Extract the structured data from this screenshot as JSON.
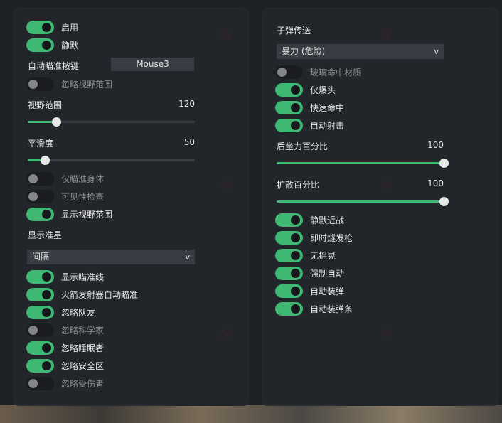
{
  "left": {
    "enable": {
      "label": "启用",
      "on": true
    },
    "silent": {
      "label": "静默",
      "on": true
    },
    "aim_key": {
      "label": "自动瞄准按键",
      "value": "Mouse3"
    },
    "ignore_fov": {
      "label": "忽略视野范围",
      "on": false
    },
    "fov": {
      "label": "视野范围",
      "value": "120",
      "fraction": 0.17
    },
    "smooth": {
      "label": "平滑度",
      "value": "50",
      "fraction": 0.1
    },
    "body_only": {
      "label": "仅瞄准身体",
      "on": false
    },
    "vis_check": {
      "label": "可见性检查",
      "on": false
    },
    "show_fov": {
      "label": "显示视野范围",
      "on": true
    },
    "crosshair": {
      "label": "显示准星",
      "selected": "间隔"
    },
    "aim_line": {
      "label": "显示瞄准线",
      "on": true
    },
    "rocket_aim": {
      "label": "火箭发射器自动瞄准",
      "on": true
    },
    "ignore_team": {
      "label": "忽略队友",
      "on": true
    },
    "ignore_scientist": {
      "label": "忽略科学家",
      "on": false
    },
    "ignore_sleepers": {
      "label": "忽略睡眠者",
      "on": true
    },
    "ignore_safezone": {
      "label": "忽略安全区",
      "on": true
    },
    "ignore_wounded": {
      "label": "忽略受伤者",
      "on": false
    }
  },
  "right": {
    "bullet_tp": {
      "label": "子弹传送",
      "selected": "暴力 (危险)"
    },
    "glass_hit": {
      "label": "玻璃命中材质",
      "on": false
    },
    "headshot_only": {
      "label": "仅爆头",
      "on": true
    },
    "fast_hit": {
      "label": "快速命中",
      "on": true
    },
    "auto_fire": {
      "label": "自动射击",
      "on": true
    },
    "recoil": {
      "label": "后坐力百分比",
      "value": "100",
      "fraction": 1.0
    },
    "spread": {
      "label": "扩散百分比",
      "value": "100",
      "fraction": 1.0
    },
    "silent_melee": {
      "label": "静默近战",
      "on": true
    },
    "instant_flint": {
      "label": "即时燧发枪",
      "on": true
    },
    "no_sway": {
      "label": "无摇晃",
      "on": true
    },
    "force_auto": {
      "label": "强制自动",
      "on": true
    },
    "auto_reload": {
      "label": "自动装弹",
      "on": true
    },
    "auto_reload_bar": {
      "label": "自动装弹条",
      "on": true
    }
  },
  "icons": {
    "dropdown": "chevron-down-icon"
  },
  "colors": {
    "accent": "#3eb872",
    "panel": "#222529",
    "background": "#1d2024"
  }
}
